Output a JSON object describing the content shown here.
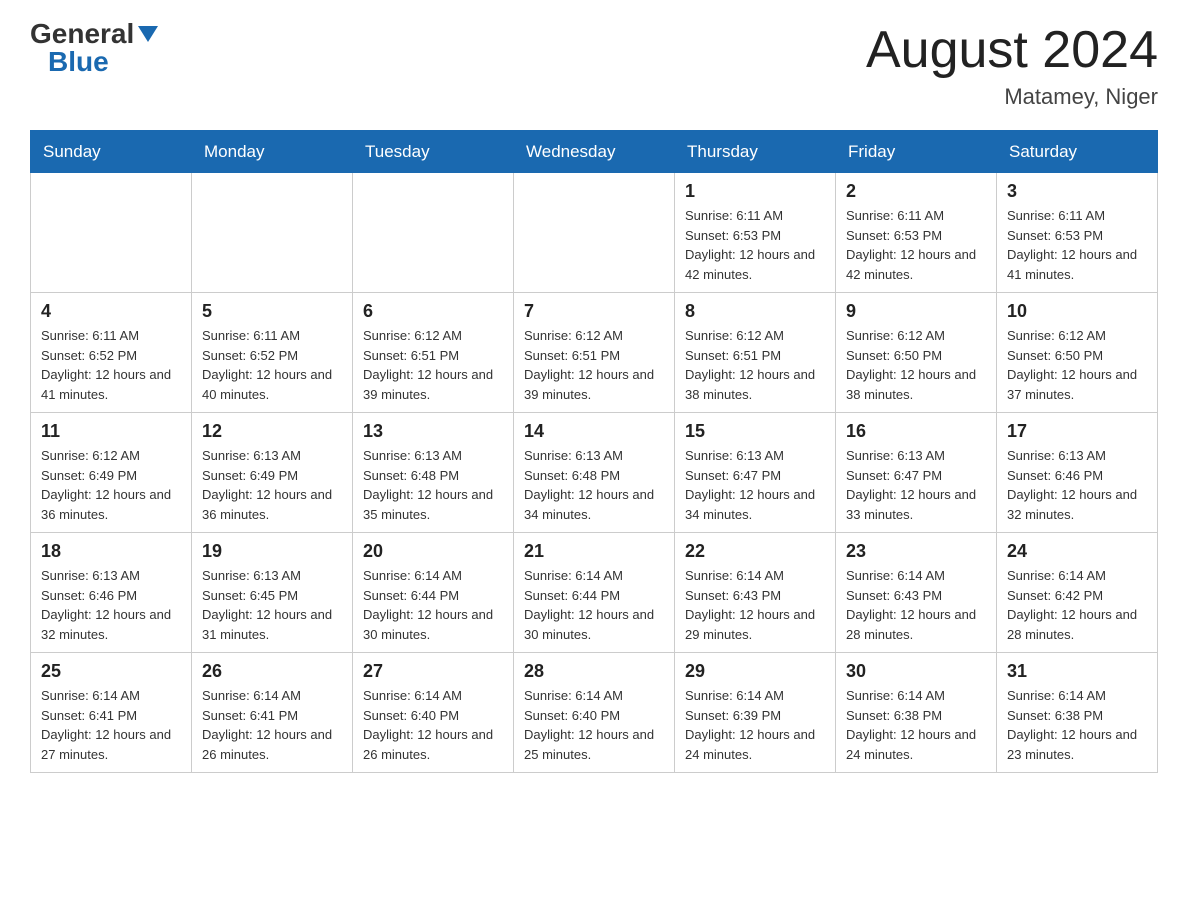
{
  "header": {
    "logo_general": "General",
    "logo_blue": "Blue",
    "title": "August 2024",
    "subtitle": "Matamey, Niger"
  },
  "days_of_week": [
    "Sunday",
    "Monday",
    "Tuesday",
    "Wednesday",
    "Thursday",
    "Friday",
    "Saturday"
  ],
  "weeks": [
    [
      {
        "day": "",
        "info": ""
      },
      {
        "day": "",
        "info": ""
      },
      {
        "day": "",
        "info": ""
      },
      {
        "day": "",
        "info": ""
      },
      {
        "day": "1",
        "info": "Sunrise: 6:11 AM\nSunset: 6:53 PM\nDaylight: 12 hours and 42 minutes."
      },
      {
        "day": "2",
        "info": "Sunrise: 6:11 AM\nSunset: 6:53 PM\nDaylight: 12 hours and 42 minutes."
      },
      {
        "day": "3",
        "info": "Sunrise: 6:11 AM\nSunset: 6:53 PM\nDaylight: 12 hours and 41 minutes."
      }
    ],
    [
      {
        "day": "4",
        "info": "Sunrise: 6:11 AM\nSunset: 6:52 PM\nDaylight: 12 hours and 41 minutes."
      },
      {
        "day": "5",
        "info": "Sunrise: 6:11 AM\nSunset: 6:52 PM\nDaylight: 12 hours and 40 minutes."
      },
      {
        "day": "6",
        "info": "Sunrise: 6:12 AM\nSunset: 6:51 PM\nDaylight: 12 hours and 39 minutes."
      },
      {
        "day": "7",
        "info": "Sunrise: 6:12 AM\nSunset: 6:51 PM\nDaylight: 12 hours and 39 minutes."
      },
      {
        "day": "8",
        "info": "Sunrise: 6:12 AM\nSunset: 6:51 PM\nDaylight: 12 hours and 38 minutes."
      },
      {
        "day": "9",
        "info": "Sunrise: 6:12 AM\nSunset: 6:50 PM\nDaylight: 12 hours and 38 minutes."
      },
      {
        "day": "10",
        "info": "Sunrise: 6:12 AM\nSunset: 6:50 PM\nDaylight: 12 hours and 37 minutes."
      }
    ],
    [
      {
        "day": "11",
        "info": "Sunrise: 6:12 AM\nSunset: 6:49 PM\nDaylight: 12 hours and 36 minutes."
      },
      {
        "day": "12",
        "info": "Sunrise: 6:13 AM\nSunset: 6:49 PM\nDaylight: 12 hours and 36 minutes."
      },
      {
        "day": "13",
        "info": "Sunrise: 6:13 AM\nSunset: 6:48 PM\nDaylight: 12 hours and 35 minutes."
      },
      {
        "day": "14",
        "info": "Sunrise: 6:13 AM\nSunset: 6:48 PM\nDaylight: 12 hours and 34 minutes."
      },
      {
        "day": "15",
        "info": "Sunrise: 6:13 AM\nSunset: 6:47 PM\nDaylight: 12 hours and 34 minutes."
      },
      {
        "day": "16",
        "info": "Sunrise: 6:13 AM\nSunset: 6:47 PM\nDaylight: 12 hours and 33 minutes."
      },
      {
        "day": "17",
        "info": "Sunrise: 6:13 AM\nSunset: 6:46 PM\nDaylight: 12 hours and 32 minutes."
      }
    ],
    [
      {
        "day": "18",
        "info": "Sunrise: 6:13 AM\nSunset: 6:46 PM\nDaylight: 12 hours and 32 minutes."
      },
      {
        "day": "19",
        "info": "Sunrise: 6:13 AM\nSunset: 6:45 PM\nDaylight: 12 hours and 31 minutes."
      },
      {
        "day": "20",
        "info": "Sunrise: 6:14 AM\nSunset: 6:44 PM\nDaylight: 12 hours and 30 minutes."
      },
      {
        "day": "21",
        "info": "Sunrise: 6:14 AM\nSunset: 6:44 PM\nDaylight: 12 hours and 30 minutes."
      },
      {
        "day": "22",
        "info": "Sunrise: 6:14 AM\nSunset: 6:43 PM\nDaylight: 12 hours and 29 minutes."
      },
      {
        "day": "23",
        "info": "Sunrise: 6:14 AM\nSunset: 6:43 PM\nDaylight: 12 hours and 28 minutes."
      },
      {
        "day": "24",
        "info": "Sunrise: 6:14 AM\nSunset: 6:42 PM\nDaylight: 12 hours and 28 minutes."
      }
    ],
    [
      {
        "day": "25",
        "info": "Sunrise: 6:14 AM\nSunset: 6:41 PM\nDaylight: 12 hours and 27 minutes."
      },
      {
        "day": "26",
        "info": "Sunrise: 6:14 AM\nSunset: 6:41 PM\nDaylight: 12 hours and 26 minutes."
      },
      {
        "day": "27",
        "info": "Sunrise: 6:14 AM\nSunset: 6:40 PM\nDaylight: 12 hours and 26 minutes."
      },
      {
        "day": "28",
        "info": "Sunrise: 6:14 AM\nSunset: 6:40 PM\nDaylight: 12 hours and 25 minutes."
      },
      {
        "day": "29",
        "info": "Sunrise: 6:14 AM\nSunset: 6:39 PM\nDaylight: 12 hours and 24 minutes."
      },
      {
        "day": "30",
        "info": "Sunrise: 6:14 AM\nSunset: 6:38 PM\nDaylight: 12 hours and 24 minutes."
      },
      {
        "day": "31",
        "info": "Sunrise: 6:14 AM\nSunset: 6:38 PM\nDaylight: 12 hours and 23 minutes."
      }
    ]
  ]
}
